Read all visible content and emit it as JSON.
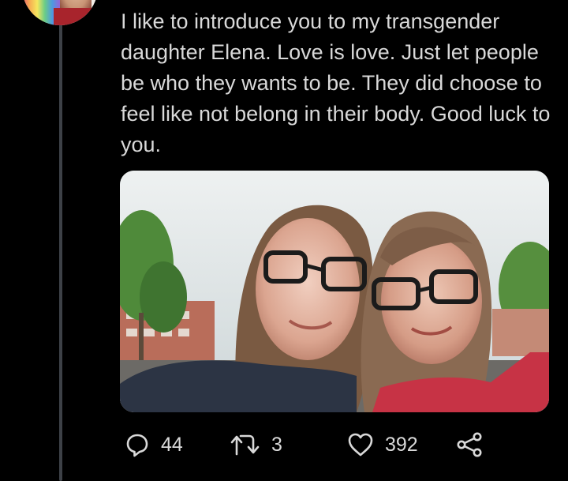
{
  "tweet": {
    "text": "I like to introduce you to my transgender daughter Elena. Love is love.  Just let people be who they wants to be. They did choose to feel like not belong in their body. Good luck to you."
  },
  "media": {
    "icon": "photo-of-two-people"
  },
  "actions": {
    "reply_count": "44",
    "retweet_count": "3",
    "like_count": "392"
  },
  "colors": {
    "background": "#000000",
    "text": "#d9d9d9",
    "thread_line": "#3d4147"
  }
}
